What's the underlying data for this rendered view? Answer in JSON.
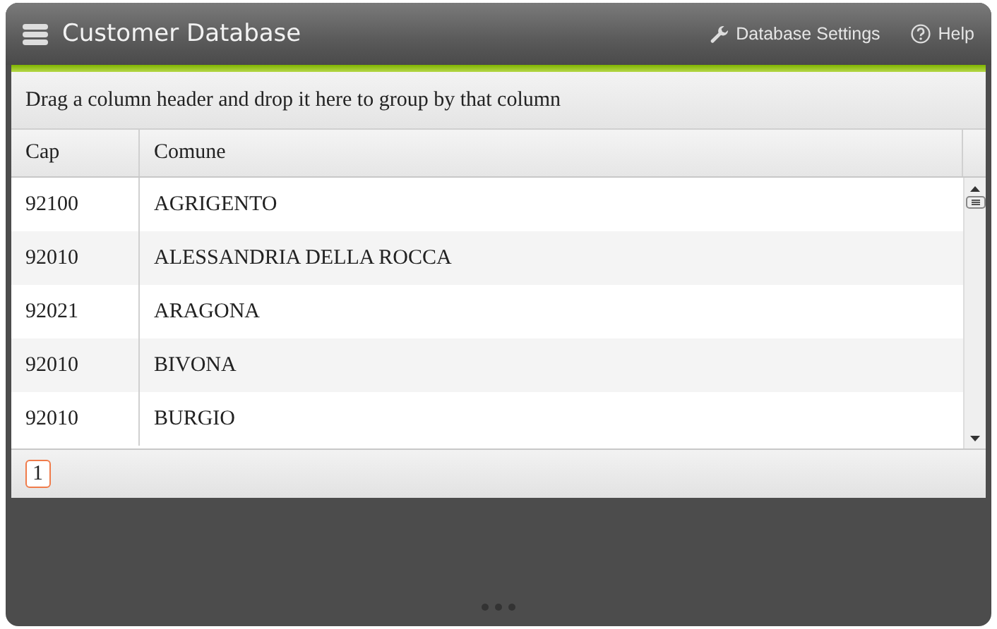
{
  "window": {
    "title": "Customer Database"
  },
  "header_links": [
    {
      "label": "Database Settings",
      "kind": "settings"
    },
    {
      "label": "Help",
      "kind": "help"
    }
  ],
  "group_bar": {
    "text": "Drag a column header and drop it here to group by that column"
  },
  "table": {
    "columns": [
      "Cap",
      "Comune"
    ],
    "rows": [
      [
        "92100",
        "AGRIGENTO"
      ],
      [
        "92010",
        "ALESSANDRIA DELLA ROCCA"
      ],
      [
        "92021",
        "ARAGONA"
      ],
      [
        "92010",
        "BIVONA"
      ],
      [
        "92010",
        "BURGIO"
      ]
    ]
  },
  "pager": [
    {
      "label": "1",
      "selected": true
    }
  ]
}
